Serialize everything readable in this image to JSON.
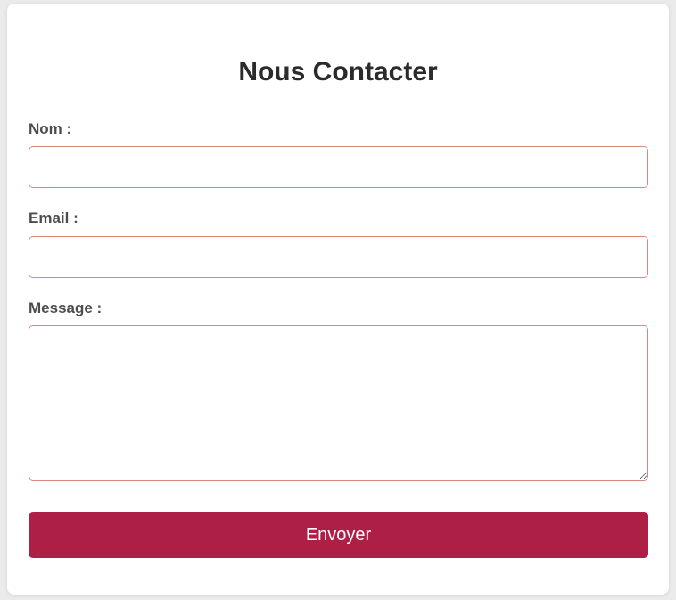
{
  "form": {
    "title": "Nous Contacter",
    "fields": {
      "name": {
        "label": "Nom :",
        "value": "",
        "placeholder": ""
      },
      "email": {
        "label": "Email :",
        "value": "",
        "placeholder": ""
      },
      "message": {
        "label": "Message :",
        "value": "",
        "placeholder": ""
      }
    },
    "submit_label": "Envoyer"
  },
  "colors": {
    "accent": "#ad1f45",
    "field_border": "#d9887d",
    "title_text": "#2b2b2b",
    "label_text": "#4d4d4d",
    "background": "#ebebeb",
    "card": "#ffffff"
  }
}
